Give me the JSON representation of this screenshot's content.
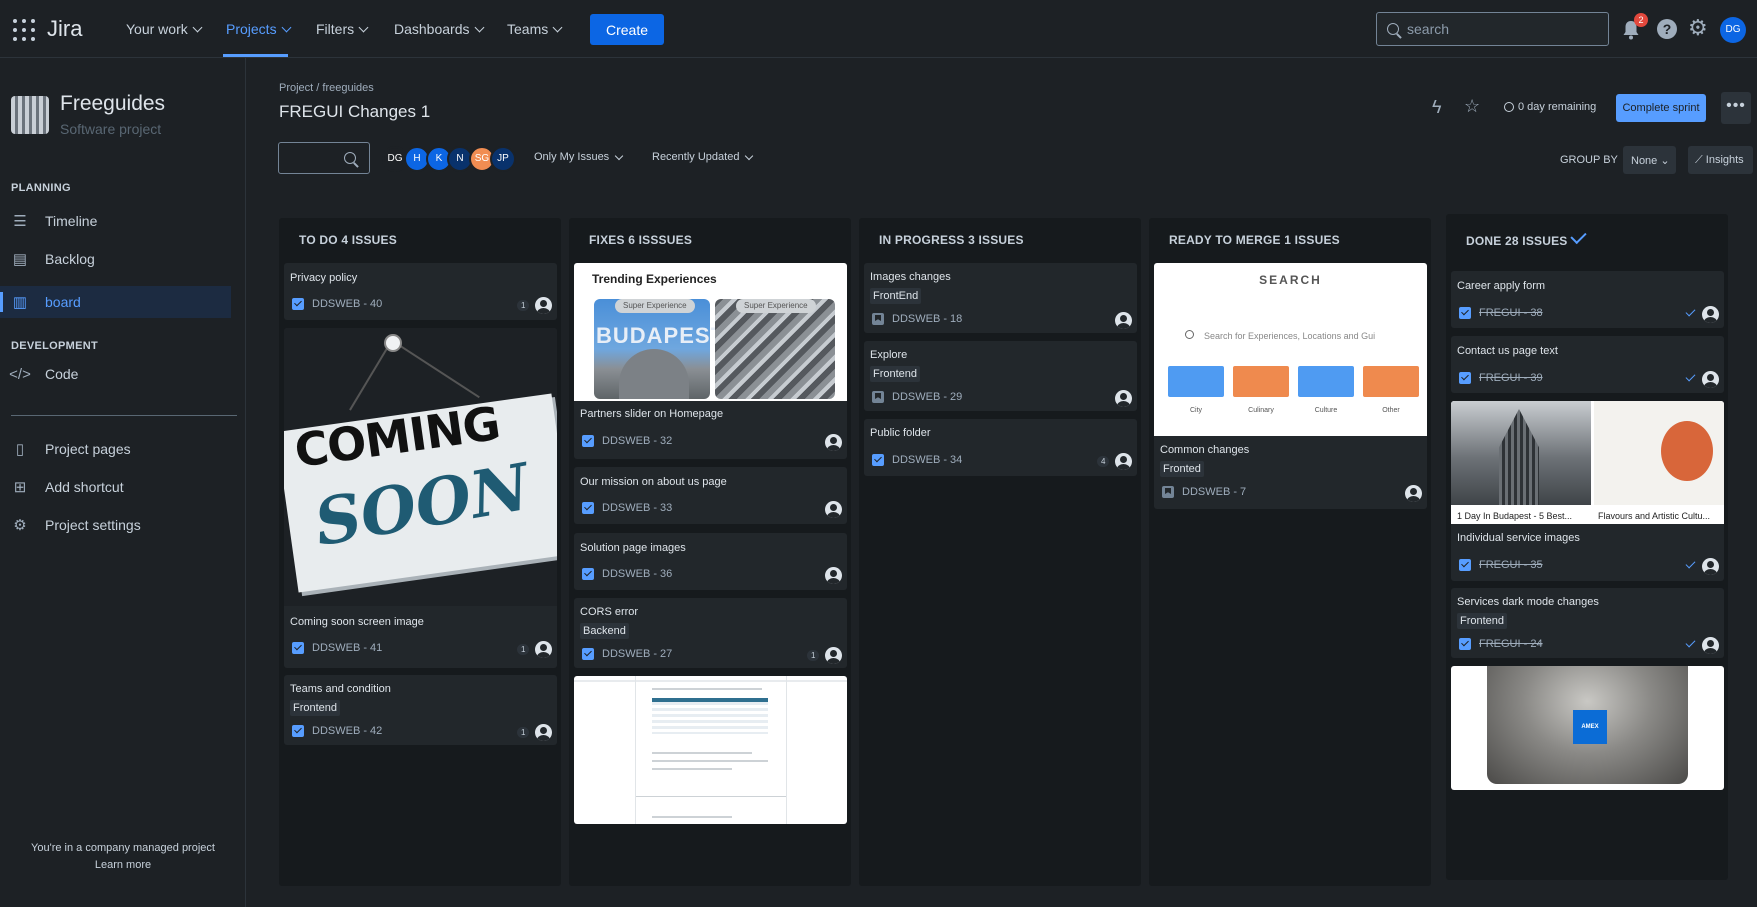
{
  "topnav": {
    "logo": "Jira",
    "items": [
      {
        "label": "Your work"
      },
      {
        "label": "Projects"
      },
      {
        "label": "Filters"
      },
      {
        "label": "Dashboards"
      },
      {
        "label": "Teams"
      }
    ],
    "create_label": "Create",
    "search_placeholder": "search",
    "notification_count": "2",
    "help_icon": "?",
    "user_initials": "DG"
  },
  "sidebar": {
    "project_name": "Freeguides",
    "project_type": "Software project",
    "planning_label": "PLANNING",
    "planning_items": [
      {
        "label": "Timeline",
        "icon": "timeline-icon"
      },
      {
        "label": "Backlog",
        "icon": "backlog-icon"
      },
      {
        "label": "board",
        "icon": "board-icon"
      }
    ],
    "development_label": "DEVELOPMENT",
    "development_items": [
      {
        "label": "Code",
        "icon": "code-icon"
      }
    ],
    "extra_items": [
      {
        "label": "Project pages",
        "icon": "pages-icon"
      },
      {
        "label": "Add shortcut",
        "icon": "add-shortcut-icon"
      },
      {
        "label": "Project settings",
        "icon": "settings-icon"
      }
    ],
    "footer_text": "You're in a company managed project",
    "footer_link": "Learn more"
  },
  "header": {
    "breadcrumb": "Project / freeguides",
    "title": "FREGUI Changes 1",
    "remaining": "0 day remaining",
    "complete_label": "Complete sprint",
    "more_label": "•••"
  },
  "filters": {
    "avatars": [
      {
        "initials": "DG",
        "color": "#1d2125"
      },
      {
        "initials": "H",
        "color": "#0c66e4"
      },
      {
        "initials": "K",
        "color": "#0c66e4"
      },
      {
        "initials": "N",
        "color": "#09326c"
      },
      {
        "initials": "SG",
        "color": "#f18d52"
      },
      {
        "initials": "JP",
        "color": "#09326c"
      }
    ],
    "only_my_issues": "Only My Issues",
    "recently_updated": "Recently Updated",
    "group_by_label": "GROUP BY",
    "group_by_value": "None",
    "insights_label": "Insights"
  },
  "columns": [
    {
      "title": "TO DO 4 ISSUES",
      "cards": [
        {
          "title": "Privacy policy",
          "key": "DDSWEB - 40",
          "estimate": "1"
        },
        {
          "title": "Coming soon screen image",
          "key": "DDSWEB - 41",
          "estimate": "1",
          "cover_text_1": "COMING",
          "cover_text_2": "SOON"
        },
        {
          "title": "Teams and condition",
          "label": "Frontend",
          "key": "DDSWEB - 42",
          "estimate": "1"
        }
      ]
    },
    {
      "title": "FIXES 6 ISSSUES",
      "cards": [
        {
          "title": "Partners slider on Homepage",
          "key": "DDSWEB - 32",
          "cover_title": "Trending Experiences",
          "cover_pill": "Super Experience",
          "cover_city": "BUDAPEST"
        },
        {
          "title": "Our mission on about us page",
          "key": "DDSWEB - 33"
        },
        {
          "title": "Solution page images",
          "key": "DDSWEB - 36"
        },
        {
          "title": "CORS error",
          "label": "Backend",
          "key": "DDSWEB - 27",
          "estimate": "1"
        }
      ]
    },
    {
      "title": "IN PROGRESS 3 ISSUES",
      "cards": [
        {
          "title": "Images changes",
          "label": "FrontEnd",
          "key": "DDSWEB - 18"
        },
        {
          "title": "Explore",
          "label": "Frontend",
          "key": "DDSWEB - 29"
        },
        {
          "title": "Public folder",
          "key": "DDSWEB - 34",
          "estimate": "4"
        }
      ]
    },
    {
      "title": "READY TO MERGE 1 ISSUES",
      "cards": [
        {
          "title": "Common changes",
          "label": "Fronted",
          "key": "DDSWEB - 7",
          "cover_title": "SEARCH",
          "cover_input": "Search for Experiences, Locations and Gui",
          "cover_tiles": [
            "City",
            "Culinary",
            "Culture",
            "Other"
          ]
        }
      ]
    },
    {
      "title": "DONE 28 ISSUES",
      "cards": [
        {
          "title": "Career apply form",
          "key": "FREGUI - 38"
        },
        {
          "title": "Contact us page text",
          "key": "FREGUI - 39"
        },
        {
          "title": "Individual service images",
          "key": "FREGUI - 35",
          "cover_caption_1": "1 Day In Budapest - 5 Best...",
          "cover_caption_2": "Flavours and Artistic Cultu..."
        },
        {
          "title": "Services dark mode changes",
          "label": "Frontend",
          "key": "FREGUI - 24"
        }
      ]
    }
  ],
  "colors": {
    "accent": "#579dff",
    "primary_button": "#0c66e4",
    "background": "#1d2125",
    "column_bg": "#161a1d",
    "card_bg": "#22272b"
  }
}
